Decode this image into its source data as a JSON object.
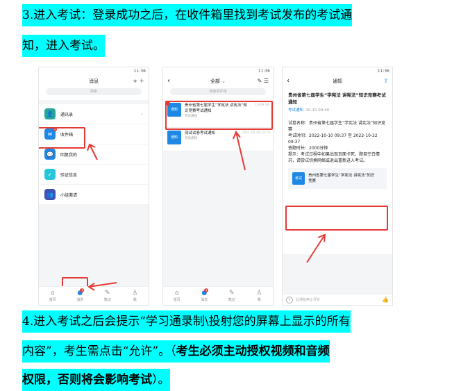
{
  "step3": {
    "line1": "3.进入考试：登录成功之后，在收件箱里找到考试发布的考试通",
    "line2": "知，进入考试。"
  },
  "step4": {
    "line1": "4.进入考试之后会提示“学习通录制\\投射您的屏幕上显示的所有",
    "line2_normal": "内容”，考生需点击“允许”。（",
    "line2_bold": "考生必须主动授权视频和音频",
    "line3_bold": "权限，否则将会影响考试",
    "line3_normal": "）。"
  },
  "status_time": "11:36",
  "phone1": {
    "title": "消息",
    "search": "搜索",
    "items": [
      {
        "label": "通讯录",
        "icon": "contacts-icon",
        "color": "#26a69a"
      },
      {
        "label": "收件箱",
        "icon": "inbox-icon",
        "color": "#1e88e5",
        "badge": "1"
      },
      {
        "label": "回复我的",
        "icon": "reply-icon",
        "color": "#1e88e5"
      },
      {
        "label": "验证信息",
        "icon": "shield-icon",
        "color": "#26c6da"
      },
      {
        "label": "小组邀请",
        "icon": "group-icon",
        "color": "#3f51b5"
      }
    ]
  },
  "phone2": {
    "title": "全部",
    "search": "搜索收件箱",
    "notices": [
      {
        "icon_text": "通知",
        "title": "贵州省第七届学生“学宪法 讲宪法”知识竞赛考试通知",
        "sub": "考试通知",
        "time": "10-09 09:",
        "dot": true
      },
      {
        "icon_text": "通知",
        "title": "测试试卷考试通知",
        "sub": "考试通知",
        "time": "2021-10-28 12:16",
        "dot": false
      }
    ]
  },
  "phone3": {
    "title": "通知",
    "heading": "贵州省第七届学生“学宪法 讲宪法”知识竞赛考试通知",
    "meta_tag": "考试通知",
    "meta_time": "10-10 09:40",
    "exam_name": "试卷名称：贵州省第七届学生“学宪法 讲宪法”知识竞赛",
    "exam_time": "考试时间：2022-10-10 09:37 至 2022-10-22 09:37",
    "duration": "答题时长：2000分钟",
    "tip": "提示：考试过程中如果出现页面卡死、题目空白情况，请尝试切换网络或退出重新进入考试。",
    "card_icon": "考试",
    "card_text": "贵州省第七届学生“学宪法 讲宪法”知识竞赛",
    "comment_placeholder": "此通知禁止评论"
  },
  "tabs": [
    {
      "label": "首页",
      "icon": "home-icon"
    },
    {
      "label": "消息",
      "icon": "message-icon",
      "active": true,
      "badge": "1"
    },
    {
      "label": "笔记",
      "icon": "note-icon"
    },
    {
      "label": "我",
      "icon": "profile-icon"
    }
  ]
}
